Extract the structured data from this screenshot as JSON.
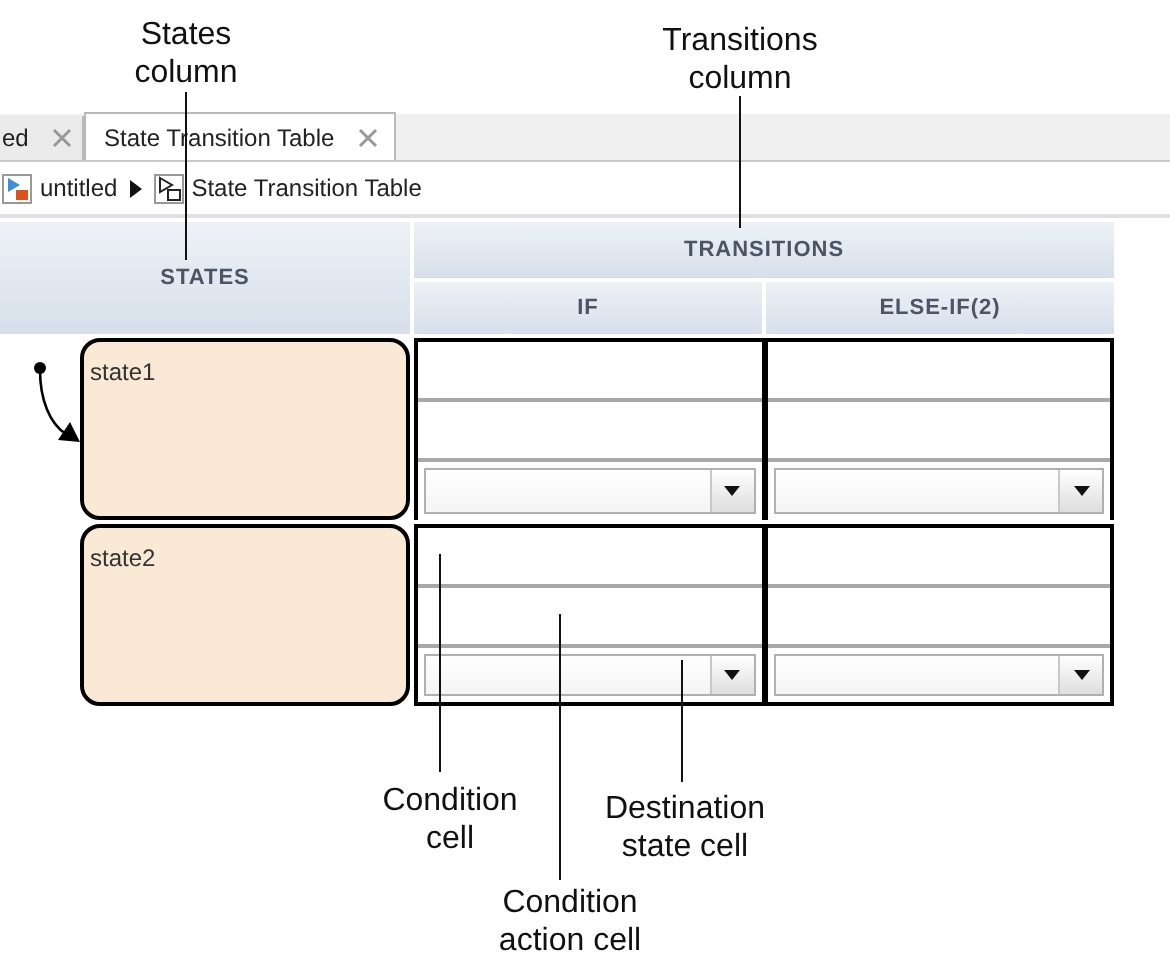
{
  "callouts_top": [
    {
      "text": "States column"
    },
    {
      "text": "Transitions column"
    }
  ],
  "tabs": [
    {
      "label": "ed",
      "selected": false
    },
    {
      "label": "State Transition Table",
      "selected": true
    }
  ],
  "breadcrumb": [
    "untitled",
    "State Transition Table"
  ],
  "table": {
    "states_header": "STATES",
    "transitions_header": "TRANSITIONS",
    "columns": [
      "IF",
      "ELSE-IF(2)"
    ],
    "rows": [
      {
        "state": "state1",
        "default_transition": true
      },
      {
        "state": "state2",
        "default_transition": false
      }
    ]
  },
  "callouts_bottom": [
    {
      "text": "Condition cell"
    },
    {
      "text": "Destination state cell"
    },
    {
      "text": "Condition action cell"
    }
  ]
}
